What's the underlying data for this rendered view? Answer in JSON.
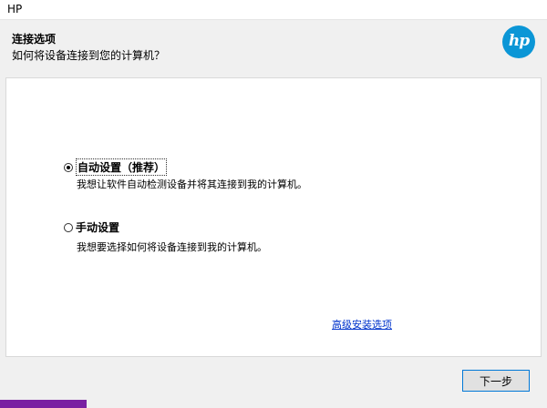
{
  "window": {
    "title": "HP"
  },
  "header": {
    "title": "连接选项",
    "subtitle": "如何将设备连接到您的计算机？",
    "logo_text": "hp",
    "logo_color": "#0b96d6"
  },
  "options": [
    {
      "label": "自动设置（推荐）",
      "description": "我想让软件自动检测设备并将其连接到我的计算机。",
      "selected": true
    },
    {
      "label": "手动设置",
      "description": "我想要选择如何将设备连接到我的计算机。",
      "selected": false
    }
  ],
  "advanced_link": "高级安装选项",
  "footer": {
    "next_label": "下一步"
  },
  "colors": {
    "link": "#0033cc",
    "button_border": "#0078d7",
    "accent_strip": "#7a1fa2"
  }
}
